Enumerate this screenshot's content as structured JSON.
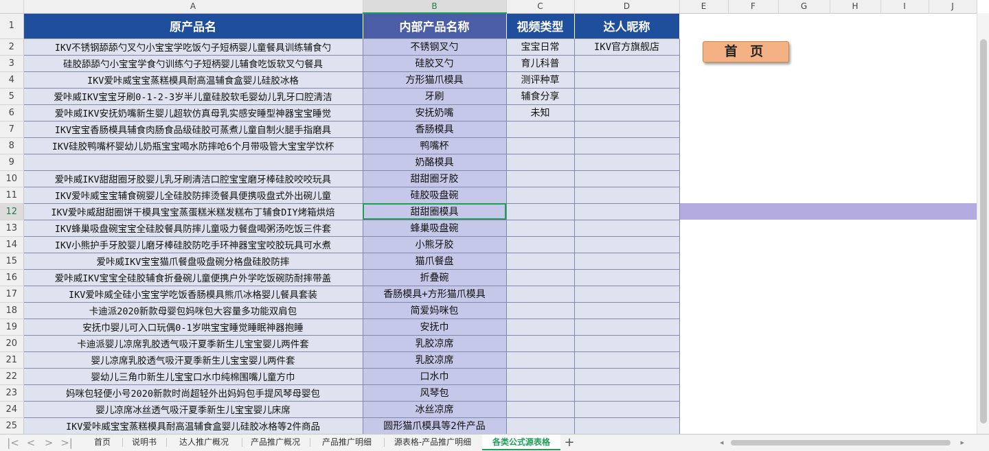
{
  "columns": [
    "A",
    "B",
    "C",
    "D",
    "E",
    "F",
    "G",
    "H",
    "I",
    "J"
  ],
  "header": {
    "row": "1",
    "a": "原产品名",
    "b": "内部产品名称",
    "c": "视频类型",
    "d": "达人昵称"
  },
  "rows": [
    {
      "n": "2",
      "a": "IKV不锈钢舔舔勺叉勺小宝宝学吃饭勺子短柄婴儿童餐具训练辅食勺",
      "b": "不锈钢叉勺",
      "c": "宝宝日常",
      "d": "IKV官方旗舰店"
    },
    {
      "n": "3",
      "a": "硅胶舔舔勺小宝宝学食勺训练勺子短柄婴儿辅食吃饭软叉勺餐具",
      "b": "硅胶叉勺",
      "c": "育儿科普",
      "d": ""
    },
    {
      "n": "4",
      "a": "IKV爱咔威宝宝蒸糕模具耐高温辅食盒婴儿硅胶冰格",
      "b": "方形猫爪模具",
      "c": "测评种草",
      "d": ""
    },
    {
      "n": "5",
      "a": "爱咔威IKV宝宝牙刷0-1-2-3岁半儿童硅胶软毛婴幼儿乳牙口腔清洁",
      "b": "牙刷",
      "c": "辅食分享",
      "d": ""
    },
    {
      "n": "6",
      "a": "爱咔威IKV安抚奶嘴新生婴儿超软仿真母乳实感安睡型神器宝宝睡觉",
      "b": "安抚奶嘴",
      "c": "未知",
      "d": ""
    },
    {
      "n": "7",
      "a": "IKV宝宝香肠模具辅食肉肠食品级硅胶可蒸煮儿童自制火腿手指磨具",
      "b": "香肠模具",
      "c": "",
      "d": ""
    },
    {
      "n": "8",
      "a": "IKV硅胶鸭嘴杯婴幼儿奶瓶宝宝喝水防摔呛6个月带吸管大宝宝学饮杯",
      "b": "鸭嘴杯",
      "c": "",
      "d": ""
    },
    {
      "n": "9",
      "a": "",
      "b": "奶酪模具",
      "c": "",
      "d": ""
    },
    {
      "n": "10",
      "a": "爱咔威IKV甜甜圈牙胶婴儿乳牙刷清洁口腔宝宝磨牙棒硅胶咬咬玩具",
      "b": "甜甜圈牙胶",
      "c": "",
      "d": ""
    },
    {
      "n": "11",
      "a": "IKV爱咔威宝宝辅食碗婴儿全硅胶防摔烫餐具便携吸盘式外出碗儿童",
      "b": "硅胶吸盘碗",
      "c": "",
      "d": ""
    },
    {
      "n": "12",
      "a": "IKV爱咔威甜甜圈饼干模具宝宝蒸蛋糕米糕发糕布丁辅食DIY烤箱烘焙",
      "b": "甜甜圈模具",
      "c": "",
      "d": ""
    },
    {
      "n": "13",
      "a": "IKV蜂巢吸盘碗宝宝全硅胶餐具防摔儿童吸力餐盘喝粥汤吃饭三件套",
      "b": "蜂巢吸盘碗",
      "c": "",
      "d": ""
    },
    {
      "n": "14",
      "a": "IKV小熊护手牙胶婴儿磨牙棒硅胶防吃手环神器宝宝咬胶玩具可水煮",
      "b": "小熊牙胶",
      "c": "",
      "d": ""
    },
    {
      "n": "15",
      "a": "爱咔威IKV宝宝猫爪餐盘吸盘碗分格盘硅胶防摔",
      "b": "猫爪餐盘",
      "c": "",
      "d": ""
    },
    {
      "n": "16",
      "a": "爱咔威IKV宝宝全硅胶辅食折叠碗儿童便携户外学吃饭碗防耐摔带盖",
      "b": "折叠碗",
      "c": "",
      "d": ""
    },
    {
      "n": "17",
      "a": "IKV爱咔威全硅小宝宝学吃饭香肠模具熊爪冰格婴儿餐具套装",
      "b": "香肠模具+方形猫爪模具",
      "c": "",
      "d": ""
    },
    {
      "n": "18",
      "a": "卡迪派2020新款母婴包妈咪包大容量多功能双肩包",
      "b": "简爱妈咪包",
      "c": "",
      "d": ""
    },
    {
      "n": "19",
      "a": "安抚巾婴儿可入口玩偶0-1岁哄宝宝睡觉睡眠神器抱睡",
      "b": "安抚巾",
      "c": "",
      "d": ""
    },
    {
      "n": "20",
      "a": "卡迪派婴儿凉席乳胶透气吸汗夏季新生儿宝宝婴儿两件套",
      "b": "乳胶凉席",
      "c": "",
      "d": ""
    },
    {
      "n": "21",
      "a": "婴儿凉席乳胶透气吸汗夏季新生儿宝宝婴儿两件套",
      "b": "乳胶凉席",
      "c": "",
      "d": ""
    },
    {
      "n": "22",
      "a": "婴幼儿三角巾新生儿宝宝口水巾纯棉围嘴儿童方巾",
      "b": "口水巾",
      "c": "",
      "d": ""
    },
    {
      "n": "23",
      "a": "妈咪包轻便小号2020新款时尚超轻外出妈妈包手提风琴母婴包",
      "b": "风琴包",
      "c": "",
      "d": ""
    },
    {
      "n": "24",
      "a": "婴儿凉席冰丝透气吸汗夏季新生儿宝宝婴儿床席",
      "b": "冰丝凉席",
      "c": "",
      "d": ""
    },
    {
      "n": "25",
      "a": "IKV爱咔威宝宝蒸糕模具耐高温辅食盒婴儿硅胶冰格等2件商品",
      "b": "圆形猫爪模具等2件产品",
      "c": "",
      "d": ""
    }
  ],
  "home_button": "首 页",
  "tabs": [
    "首页",
    "说明书",
    "达人推广概况",
    "产品推广概况",
    "产品推广明细",
    "源表格-产品推广明细",
    "各类公式源表格"
  ],
  "active_tab": "各类公式源表格",
  "colors": {
    "header_blue": "#1f4e9c",
    "header_b": "#4c5da8",
    "cell_light": "#dfe3ef",
    "cell_b": "#c5c8e8",
    "row_highlight": "#b4abe0",
    "button_orange": "#f3b184",
    "active_green": "#1f9d57"
  }
}
